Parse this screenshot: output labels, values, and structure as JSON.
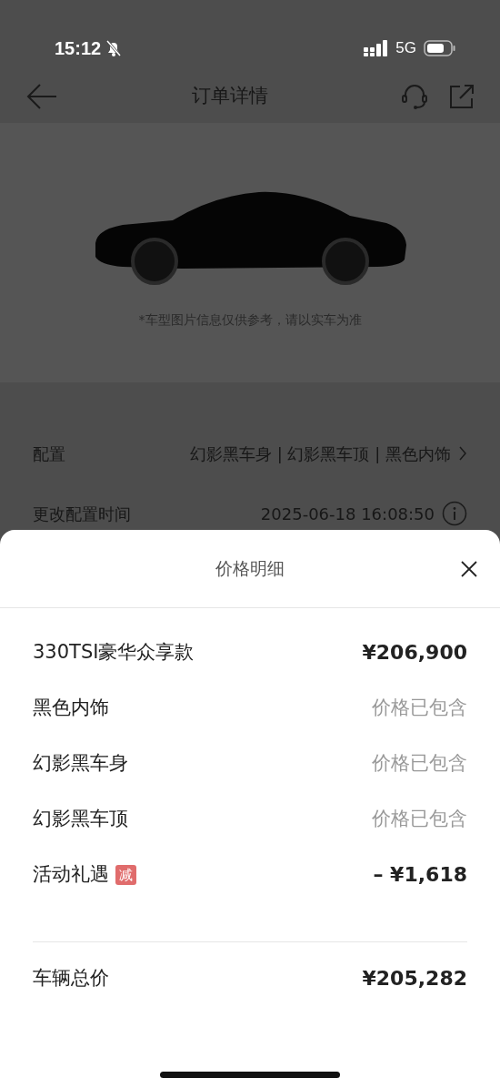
{
  "status_bar": {
    "time": "15:12",
    "network": "5G"
  },
  "nav": {
    "title": "订单详情"
  },
  "car_caption": "*车型图片信息仅供参考，请以实车为准",
  "details": [
    {
      "label": "配置",
      "value": "幻影黑车身 | 幻影黑车顶 | 黑色内饰",
      "kind": "link"
    },
    {
      "label": "更改配置时间",
      "value": "2025-06-18 16:08:50",
      "kind": "info"
    }
  ],
  "sheet": {
    "title": "价格明细",
    "items": [
      {
        "label": "330TSI豪华众享款",
        "value": "¥206,900",
        "kind": "price"
      },
      {
        "label": "黑色内饰",
        "value": "价格已包含",
        "kind": "included"
      },
      {
        "label": "幻影黑车身",
        "value": "价格已包含",
        "kind": "included"
      },
      {
        "label": "幻影黑车顶",
        "value": "价格已包含",
        "kind": "included"
      },
      {
        "label": "活动礼遇",
        "tag": "减",
        "value": "– ¥1,618",
        "kind": "discount"
      }
    ],
    "total": {
      "label": "车辆总价",
      "value": "¥205,282"
    }
  }
}
